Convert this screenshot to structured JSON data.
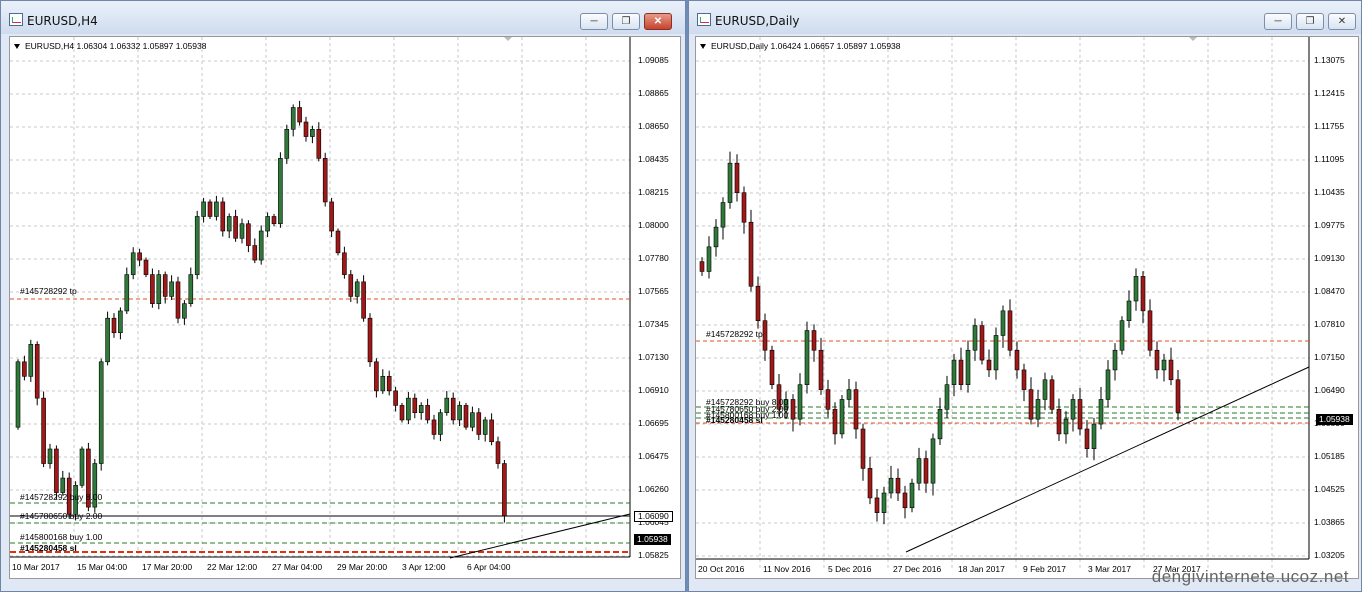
{
  "left": {
    "window_title": "EURUSD,H4",
    "symbol_info": "EURUSD,H4  1.06304 1.06332 1.05897 1.05938",
    "price_labels": [
      "1.09085",
      "1.08865",
      "1.08650",
      "1.08435",
      "1.08215",
      "1.08000",
      "1.07780",
      "1.07565",
      "1.07345",
      "1.07130",
      "1.06910",
      "1.06695",
      "1.06475",
      "1.06260",
      "1.06045",
      "1.05825"
    ],
    "time_labels": [
      "10 Mar 2017",
      "15 Mar 04:00",
      "17 Mar 20:00",
      "22 Mar 12:00",
      "27 Mar 04:00",
      "29 Mar 20:00",
      "3 Apr 12:00",
      "6 Apr 04:00"
    ],
    "order_labels": [
      "#145728292 tp",
      "#145728292 buy 8.00",
      "#145780650 buy 2.00",
      "#145800168 buy 1.00",
      "#145280458 sl"
    ],
    "price_box_current": "1.05938",
    "price_box_line": "1.06090",
    "candles": [
      [
        1.0655,
        1.07
      ],
      [
        1.07,
        1.069
      ],
      [
        1.069,
        1.0712
      ],
      [
        1.0712,
        1.0675
      ],
      [
        1.0675,
        1.063
      ],
      [
        1.063,
        1.064
      ],
      [
        1.064,
        1.061
      ],
      [
        1.061,
        1.062
      ],
      [
        1.062,
        1.0595
      ],
      [
        1.0595,
        1.0615
      ],
      [
        1.0615,
        1.064
      ],
      [
        1.064,
        1.06
      ],
      [
        1.06,
        1.063
      ],
      [
        1.063,
        1.07
      ],
      [
        1.07,
        1.073
      ],
      [
        1.073,
        1.072
      ],
      [
        1.072,
        1.0735
      ],
      [
        1.0735,
        1.076
      ],
      [
        1.076,
        1.0775
      ],
      [
        1.0775,
        1.077
      ],
      [
        1.077,
        1.076
      ],
      [
        1.076,
        1.074
      ],
      [
        1.074,
        1.076
      ],
      [
        1.076,
        1.0745
      ],
      [
        1.0745,
        1.0755
      ],
      [
        1.0755,
        1.073
      ],
      [
        1.073,
        1.074
      ],
      [
        1.074,
        1.076
      ],
      [
        1.076,
        1.08
      ],
      [
        1.08,
        1.081
      ],
      [
        1.081,
        1.08
      ],
      [
        1.08,
        1.081
      ],
      [
        1.081,
        1.079
      ],
      [
        1.079,
        1.08
      ],
      [
        1.08,
        1.0785
      ],
      [
        1.0785,
        1.0795
      ],
      [
        1.0795,
        1.078
      ],
      [
        1.078,
        1.077
      ],
      [
        1.077,
        1.079
      ],
      [
        1.079,
        1.08
      ],
      [
        1.08,
        1.0795
      ],
      [
        1.0795,
        1.084
      ],
      [
        1.084,
        1.086
      ],
      [
        1.086,
        1.0875
      ],
      [
        1.0875,
        1.0865
      ],
      [
        1.0865,
        1.0855
      ],
      [
        1.0855,
        1.086
      ],
      [
        1.086,
        1.084
      ],
      [
        1.084,
        1.081
      ],
      [
        1.081,
        1.079
      ],
      [
        1.079,
        1.0775
      ],
      [
        1.0775,
        1.076
      ],
      [
        1.076,
        1.0745
      ],
      [
        1.0745,
        1.0755
      ],
      [
        1.0755,
        1.073
      ],
      [
        1.073,
        1.07
      ],
      [
        1.07,
        1.068
      ],
      [
        1.068,
        1.069
      ],
      [
        1.069,
        1.068
      ],
      [
        1.068,
        1.067
      ],
      [
        1.067,
        1.066
      ],
      [
        1.066,
        1.0675
      ],
      [
        1.0675,
        1.0665
      ],
      [
        1.0665,
        1.067
      ],
      [
        1.067,
        1.066
      ],
      [
        1.066,
        1.065
      ],
      [
        1.065,
        1.0665
      ],
      [
        1.0665,
        1.0675
      ],
      [
        1.0675,
        1.066
      ],
      [
        1.066,
        1.067
      ],
      [
        1.067,
        1.0655
      ],
      [
        1.0655,
        1.0665
      ],
      [
        1.0665,
        1.065
      ],
      [
        1.065,
        1.066
      ],
      [
        1.066,
        1.0645
      ],
      [
        1.0645,
        1.063
      ],
      [
        1.063,
        1.0594
      ]
    ],
    "chart_data": {
      "type": "candlestick",
      "series": [
        {
          "name": "EURUSD,H4"
        }
      ],
      "ylim": [
        1.0576,
        1.0918
      ]
    }
  },
  "right": {
    "window_title": "EURUSD,Daily",
    "symbol_info": "EURUSD,Daily  1.06424 1.06657 1.05897 1.05938",
    "price_labels": [
      "1.13075",
      "1.12415",
      "1.11755",
      "1.11095",
      "1.10435",
      "1.09775",
      "1.09130",
      "1.08470",
      "1.07810",
      "1.07150",
      "1.06490",
      "1.05830",
      "1.05185",
      "1.04525",
      "1.03865",
      "1.03205"
    ],
    "time_labels": [
      "20 Oct 2016",
      "11 Nov 2016",
      "5 Dec 2016",
      "27 Dec 2016",
      "18 Jan 2017",
      "9 Feb 2017",
      "3 Mar 2017",
      "27 Mar 2017"
    ],
    "order_labels": [
      "#145728292 tp",
      "#145728292 buy 8.00",
      "#145780650 buy 2.00",
      "#145800168 buy 1.00",
      "#145280458 sl"
    ],
    "price_box_current": "1.05938",
    "candles": [
      [
        1.09,
        1.088
      ],
      [
        1.088,
        1.093
      ],
      [
        1.093,
        1.097
      ],
      [
        1.097,
        1.102
      ],
      [
        1.102,
        1.11
      ],
      [
        1.11,
        1.104
      ],
      [
        1.104,
        1.098
      ],
      [
        1.098,
        1.085
      ],
      [
        1.085,
        1.078
      ],
      [
        1.078,
        1.072
      ],
      [
        1.072,
        1.065
      ],
      [
        1.065,
        1.06
      ],
      [
        1.06,
        1.062
      ],
      [
        1.062,
        1.058
      ],
      [
        1.058,
        1.065
      ],
      [
        1.065,
        1.076
      ],
      [
        1.076,
        1.072
      ],
      [
        1.072,
        1.064
      ],
      [
        1.064,
        1.06
      ],
      [
        1.06,
        1.055
      ],
      [
        1.055,
        1.062
      ],
      [
        1.062,
        1.064
      ],
      [
        1.064,
        1.056
      ],
      [
        1.056,
        1.048
      ],
      [
        1.048,
        1.042
      ],
      [
        1.042,
        1.039
      ],
      [
        1.039,
        1.043
      ],
      [
        1.043,
        1.046
      ],
      [
        1.046,
        1.043
      ],
      [
        1.043,
        1.04
      ],
      [
        1.04,
        1.045
      ],
      [
        1.045,
        1.05
      ],
      [
        1.05,
        1.045
      ],
      [
        1.045,
        1.054
      ],
      [
        1.054,
        1.06
      ],
      [
        1.06,
        1.065
      ],
      [
        1.065,
        1.07
      ],
      [
        1.07,
        1.065
      ],
      [
        1.065,
        1.072
      ],
      [
        1.072,
        1.077
      ],
      [
        1.077,
        1.07
      ],
      [
        1.07,
        1.068
      ],
      [
        1.068,
        1.075
      ],
      [
        1.075,
        1.08
      ],
      [
        1.08,
        1.072
      ],
      [
        1.072,
        1.068
      ],
      [
        1.068,
        1.064
      ],
      [
        1.064,
        1.058
      ],
      [
        1.058,
        1.062
      ],
      [
        1.062,
        1.066
      ],
      [
        1.066,
        1.06
      ],
      [
        1.06,
        1.055
      ],
      [
        1.055,
        1.058
      ],
      [
        1.058,
        1.062
      ],
      [
        1.062,
        1.056
      ],
      [
        1.056,
        1.052
      ],
      [
        1.052,
        1.057
      ],
      [
        1.057,
        1.062
      ],
      [
        1.062,
        1.068
      ],
      [
        1.068,
        1.072
      ],
      [
        1.072,
        1.078
      ],
      [
        1.078,
        1.082
      ],
      [
        1.082,
        1.087
      ],
      [
        1.087,
        1.08
      ],
      [
        1.08,
        1.072
      ],
      [
        1.072,
        1.068
      ],
      [
        1.068,
        1.07
      ],
      [
        1.07,
        1.066
      ],
      [
        1.066,
        1.0594
      ]
    ],
    "chart_data": {
      "type": "candlestick",
      "series": [
        {
          "name": "EURUSD,Daily"
        }
      ],
      "ylim": [
        1.03,
        1.134
      ]
    }
  },
  "watermark": "dengivinternete.ucoz.net"
}
